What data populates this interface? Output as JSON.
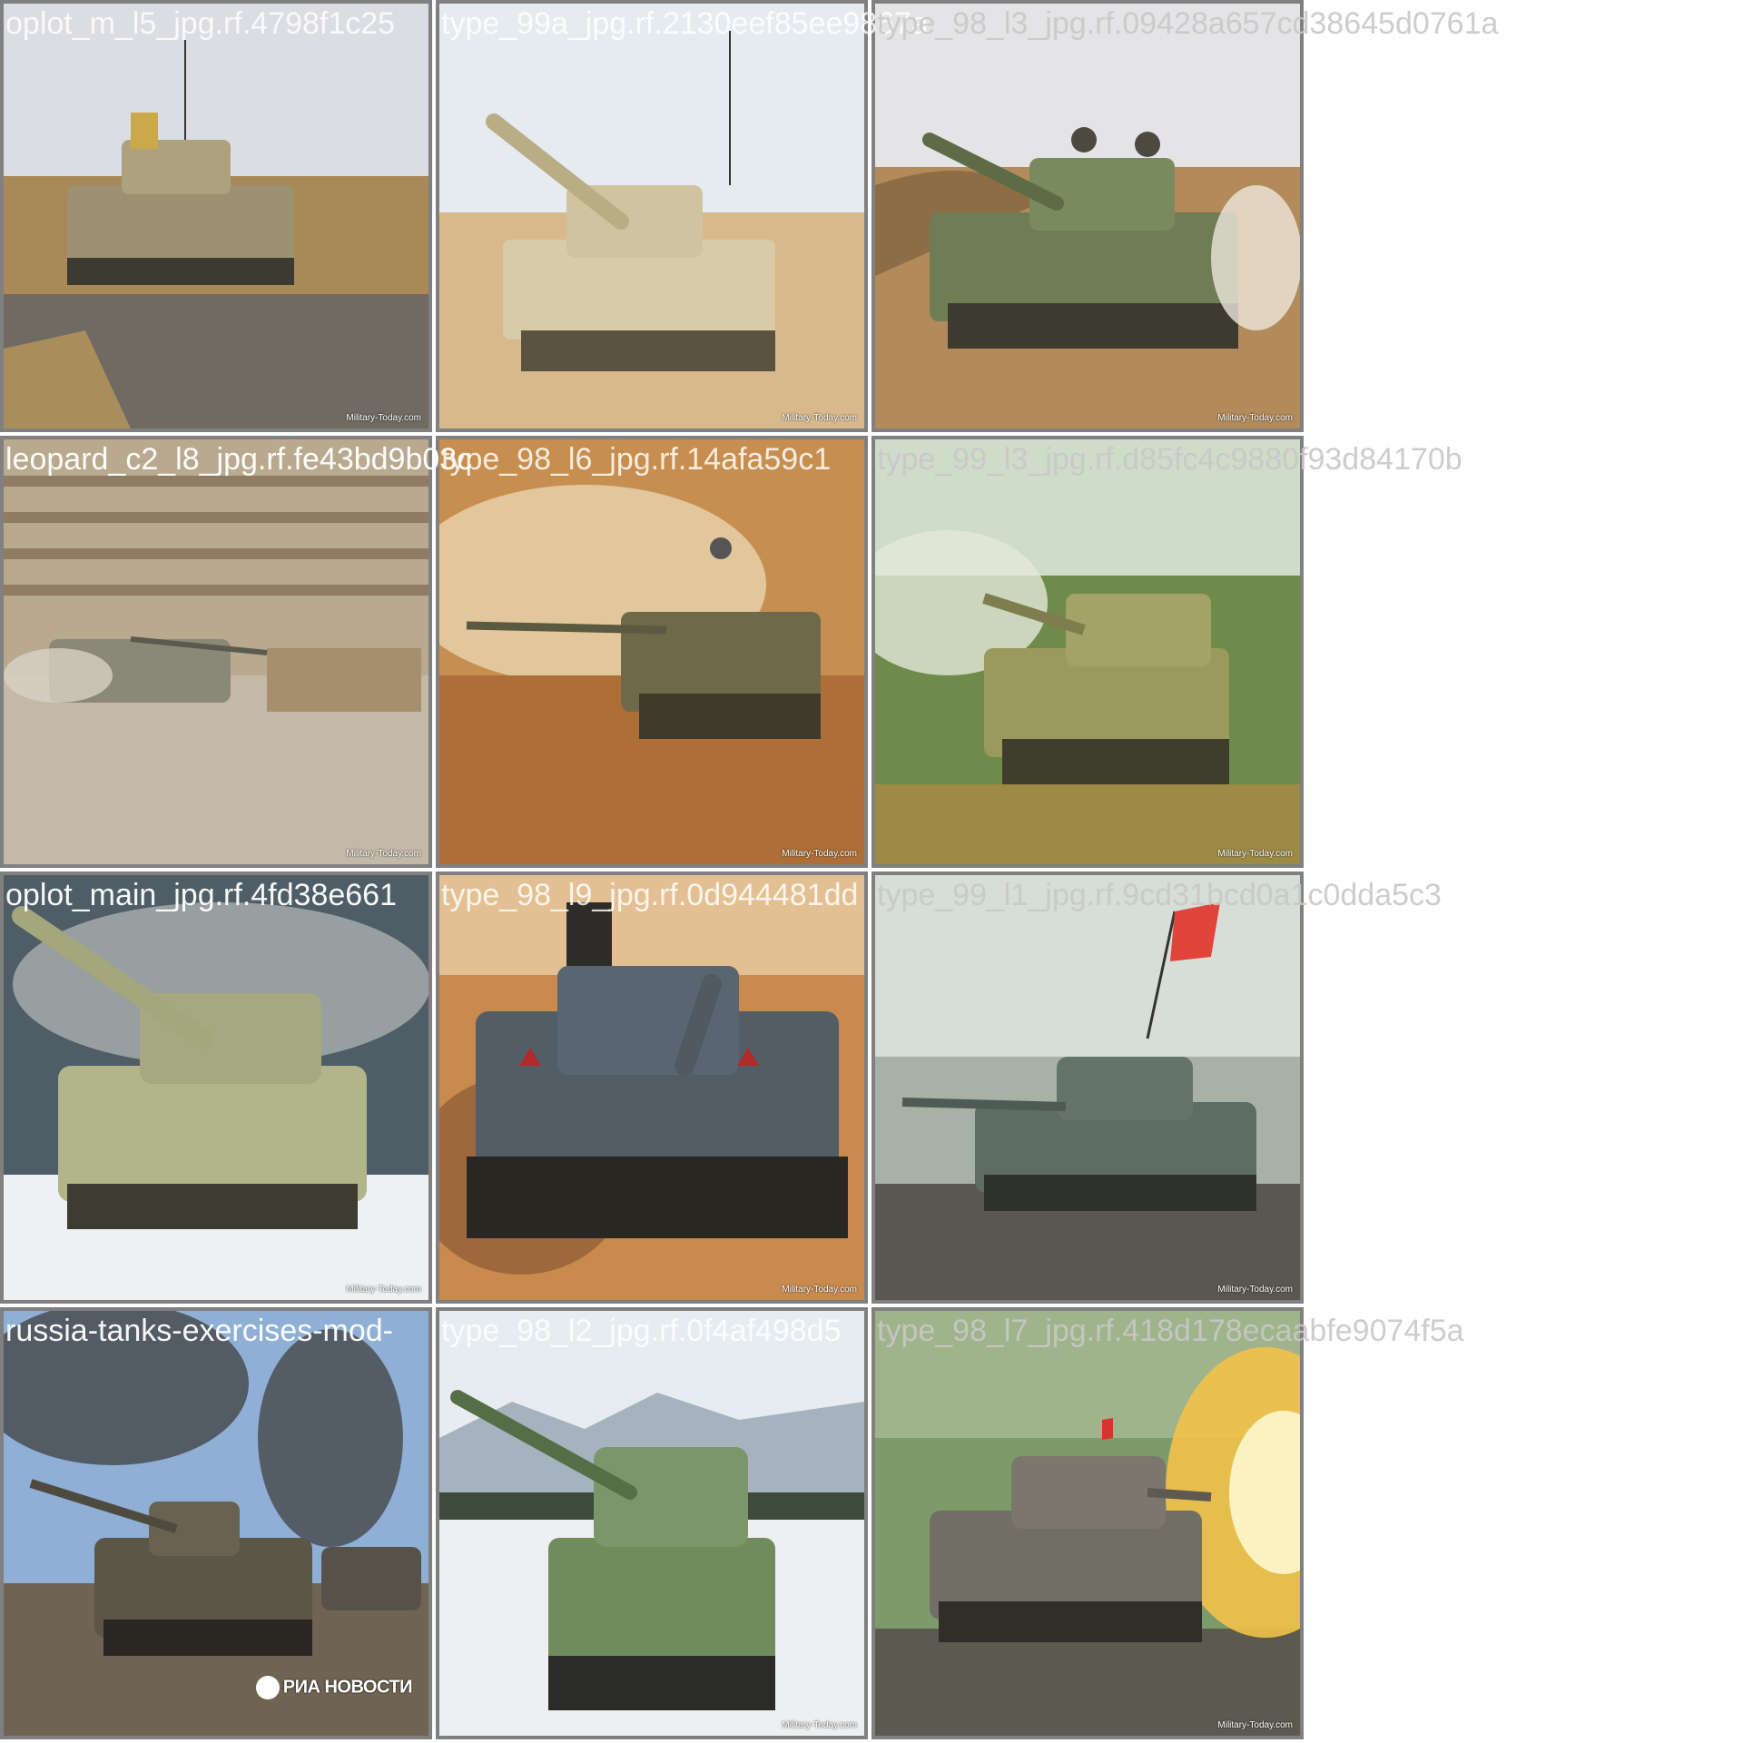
{
  "tiles": [
    {
      "label": "oplot_m_l5_jpg.rf.4798f1c25",
      "credit": "Military-Today.com"
    },
    {
      "label": "type_99a_jpg.rf.2130eef85ee9867a",
      "credit": "Military-Today.com"
    },
    {
      "label": "type_98_l3_jpg.rf.09428a657cd38645d0761a",
      "credit": "Military-Today.com"
    },
    {
      "label": "leopard_c2_l8_jpg.rf.fe43bd9b03c",
      "credit": "Military-Today.com"
    },
    {
      "label": "type_98_l6_jpg.rf.14afa59c1",
      "credit": "Military-Today.com"
    },
    {
      "label": "type_99_l3_jpg.rf.d85fc4c9880f93d84170b",
      "credit": "Military-Today.com"
    },
    {
      "label": "oplot_main_jpg.rf.4fd38e661",
      "credit": "Military-Today.com"
    },
    {
      "label": "type_98_l9_jpg.rf.0d944481dd",
      "credit": "Military-Today.com"
    },
    {
      "label": "type_99_l1_jpg.rf.9cd31bcd0a1c0dda5c3",
      "credit": "Military-Today.com"
    },
    {
      "label": "russia-tanks-exercises-mod-",
      "credit": "РИА НОВОСТИ"
    },
    {
      "label": "type_98_l2_jpg.rf.0f4af498d5",
      "credit": "Military-Today.com"
    },
    {
      "label": "type_98_l7_jpg.rf.418d178ecaabfe9074f5a",
      "credit": "Military-Today.com"
    }
  ]
}
